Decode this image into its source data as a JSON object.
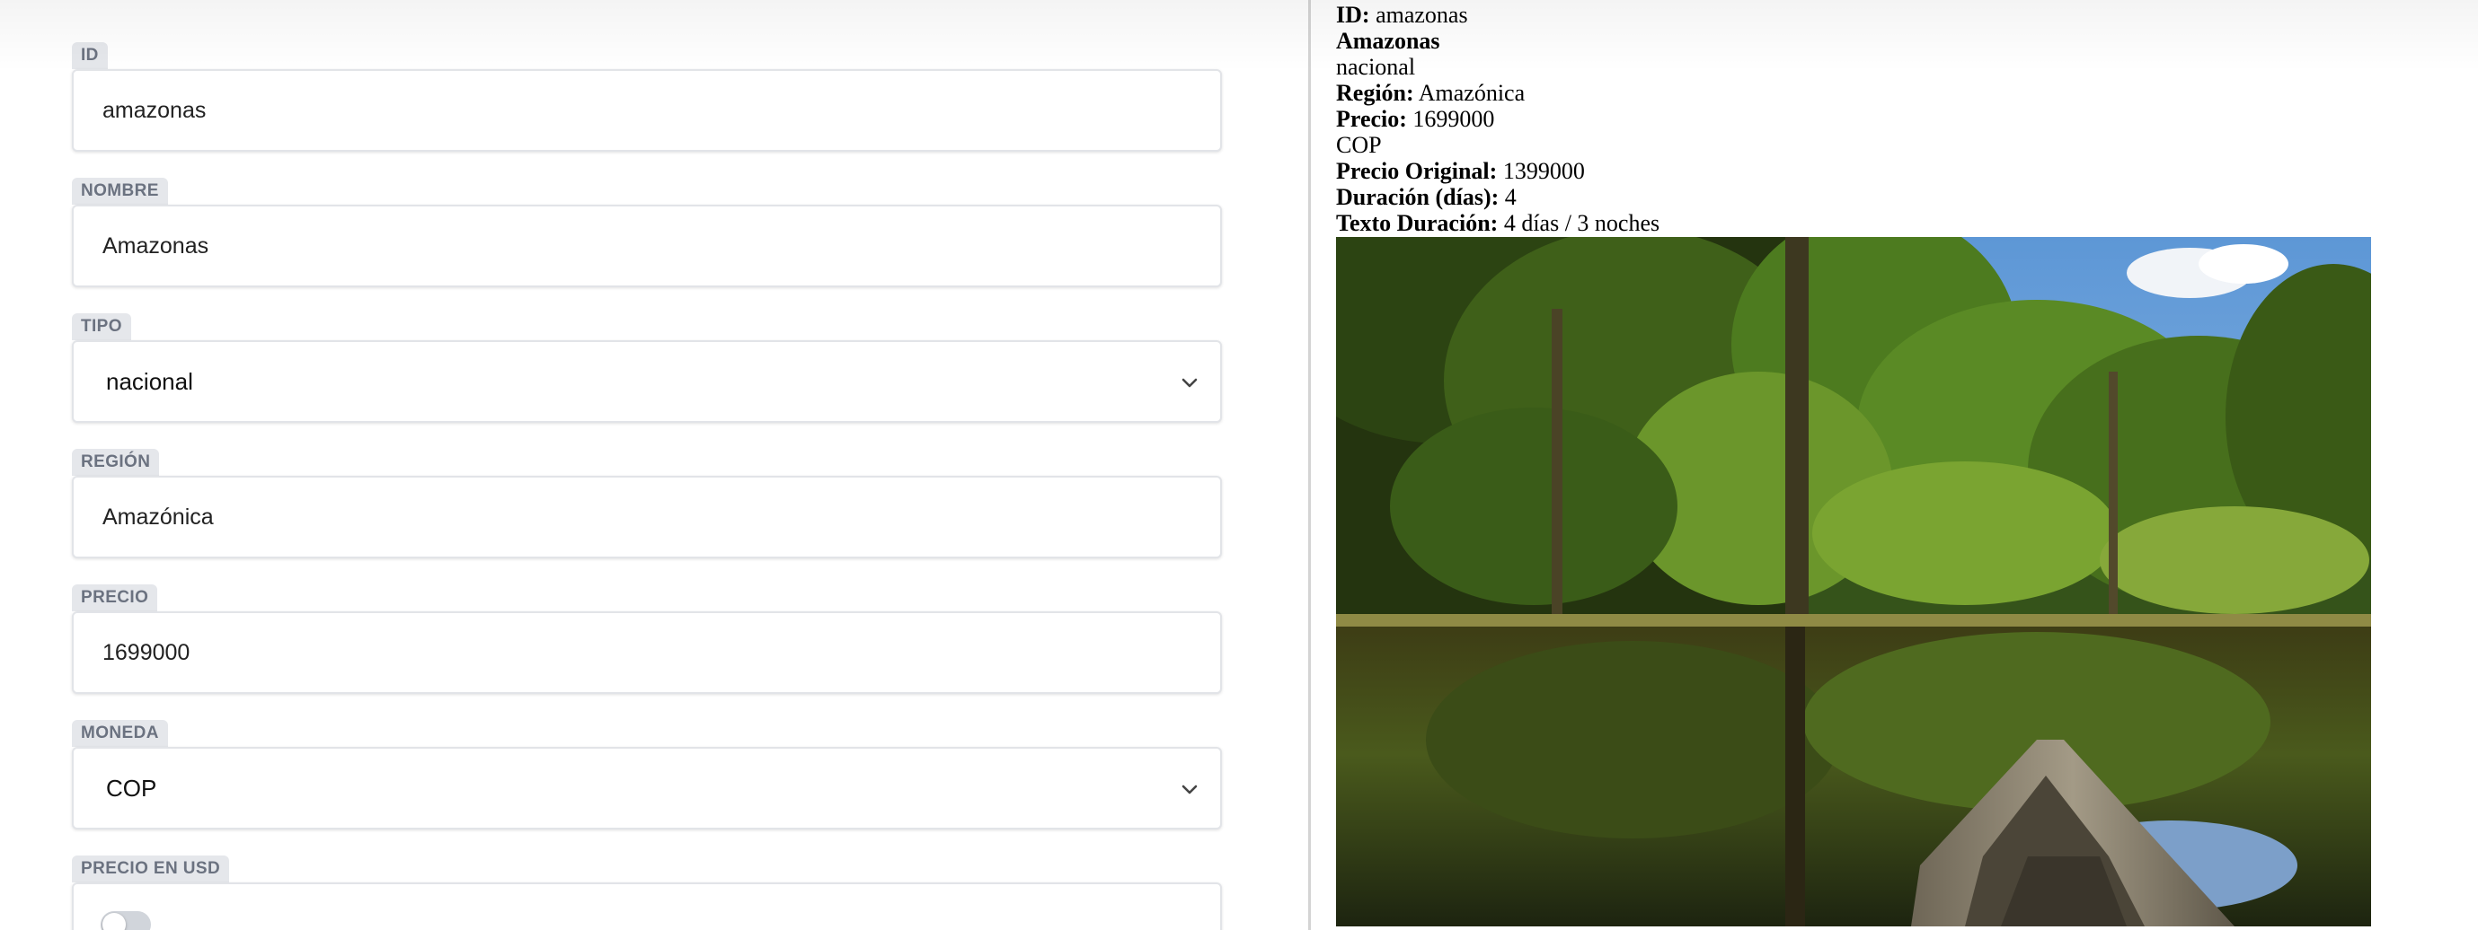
{
  "editor": {
    "fields": [
      {
        "label": "ID",
        "value": "amazonas"
      },
      {
        "label": "NOMBRE",
        "value": "Amazonas"
      },
      {
        "label": "TIPO",
        "value": "nacional"
      },
      {
        "label": "REGIÓN",
        "value": "Amazónica"
      },
      {
        "label": "PRECIO",
        "value": "1699000"
      },
      {
        "label": "MONEDA",
        "value": "COP"
      },
      {
        "label": "PRECIO EN USD",
        "value": ""
      }
    ],
    "precio_usd_toggle_on": false
  },
  "preview": {
    "id_label": "ID:",
    "id_value": "amazonas",
    "name": "Amazonas",
    "tipo": "nacional",
    "region_label": "Región:",
    "region_value": "Amazónica",
    "precio_label": "Precio:",
    "precio_value": "1699000",
    "moneda": "COP",
    "precio_original_label": "Precio Original:",
    "precio_original_value": "1399000",
    "duracion_label": "Duración (días):",
    "duracion_value": "4",
    "texto_duracion_label": "Texto Duración:",
    "texto_duracion_value": "4 días / 3 noches",
    "image_icon": "amazon-river-canoe-photo"
  },
  "colors": {
    "label_bg": "#e5e7eb",
    "label_text": "#6b7280",
    "field_border": "#e2e4e8",
    "divider": "#d4d4d4"
  }
}
